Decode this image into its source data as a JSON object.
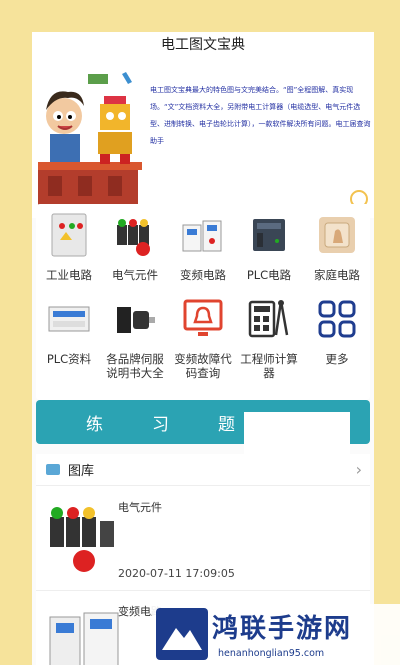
{
  "app": {
    "title": "电工图文宝典"
  },
  "banner": {
    "text": "电工图文宝典最大的特色图与文完美结合。“图”全程图解、真实现场。“文”文档资料大全，另附带电工计算器（电缆选型、电气元件选型、进制转换、电子齿轮比计算），一款软件解决所有问题。电工届查询助手"
  },
  "menu": [
    {
      "label": "工业电路",
      "icon": "control-cabinet-icon"
    },
    {
      "label": "电气元件",
      "icon": "push-button-icon"
    },
    {
      "label": "变频电路",
      "icon": "inverter-icon"
    },
    {
      "label": "PLC电路",
      "icon": "plc-module-icon"
    },
    {
      "label": "家庭电路",
      "icon": "wall-switch-icon"
    },
    {
      "label": "PLC资料",
      "icon": "plc-device-icon"
    },
    {
      "label": "各品牌伺服说明书大全",
      "icon": "servo-motor-icon"
    },
    {
      "label": "变频故障代码查询",
      "icon": "alarm-icon"
    },
    {
      "label": "工程师计算器",
      "icon": "calculator-icon"
    },
    {
      "label": "更多",
      "icon": "more-grid-icon"
    }
  ],
  "practice": {
    "chars": [
      "练",
      "习",
      "题"
    ]
  },
  "gallery": {
    "title": "图库",
    "items": [
      {
        "name": "电气元件",
        "time": "2020-07-11 17:09:05"
      },
      {
        "name": "变频电路",
        "time": ""
      }
    ]
  },
  "watermark": {
    "title": "鸿联手游网",
    "url": "henanhonglian95.com"
  },
  "colors": {
    "background": "#f6e39b",
    "practice_bar": "#2ba3b3",
    "banner_text": "#2431a3",
    "watermark": "#1d3c8c"
  }
}
